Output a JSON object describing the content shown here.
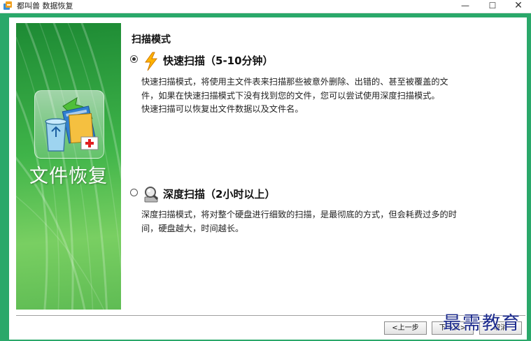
{
  "window": {
    "title": "都叫兽 数据恢复",
    "minimize_glyph": "—",
    "maximize_glyph": "☐",
    "close_glyph": "✕"
  },
  "sidebar": {
    "title": "文件恢复",
    "logo_icon": "recycle-bin-files-icon"
  },
  "main": {
    "section_title": "扫描模式",
    "options": [
      {
        "id": "fast",
        "selected": true,
        "icon": "lightning-icon",
        "label": "快速扫描（5-10分钟）",
        "description": [
          "快速扫描模式，将使用主文件表来扫描那些被意外删除、出错的、甚至被覆盖的文",
          "件，如果在快速扫描模式下没有找到您的文件，您可以尝试使用深度扫描模式。",
          "快速扫描可以恢复出文件数据以及文件名。"
        ]
      },
      {
        "id": "deep",
        "selected": false,
        "icon": "magnifier-disk-icon",
        "label": "深度扫描（2小时以上）",
        "description": [
          "深度扫描模式，将对整个硬盘进行细致的扫描，是最彻底的方式，但会耗费过多的时",
          "间，硬盘越大，时间越长。"
        ]
      }
    ]
  },
  "footer": {
    "prev_label": "<上一步",
    "next_label": "下一步>",
    "cancel_label": "取消"
  },
  "watermark": "最需教育",
  "colors": {
    "frame_green": "#2aa86a",
    "sidebar_green": "#3fb449",
    "watermark_blue": "#1b2a8c"
  }
}
